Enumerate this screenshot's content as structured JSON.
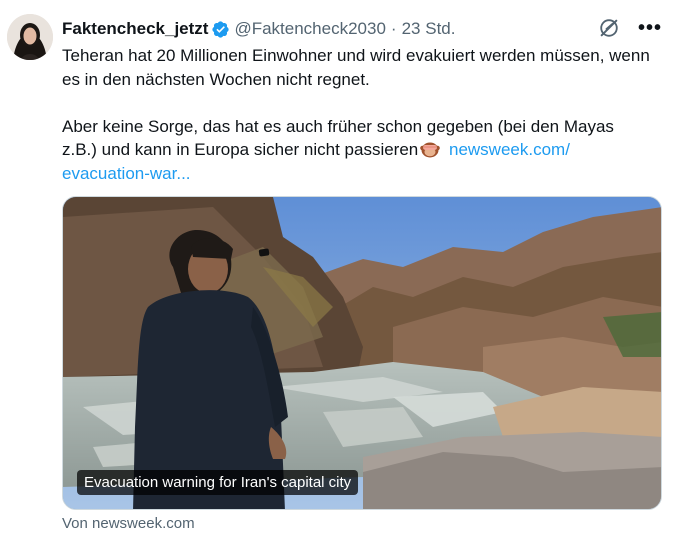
{
  "author": {
    "display_name": "Faktencheck_jetzt",
    "handle": "@Faktencheck2030",
    "time": "23 Std.",
    "separator": "·",
    "verified_icon": "verified-badge-icon"
  },
  "toolbar": {
    "grok_icon": "grok-icon",
    "more_icon": "more-icon"
  },
  "tweet": {
    "paragraph1": "Teheran hat 20 Millionen Einwohner und wird evakuiert werden müssen, wenn es in den nächsten Wochen nicht regnet.",
    "paragraph2": "Aber keine Sorge, das hat es auch früher schon gegeben (bei den Mayas z.B.) und kann in Europa sicher nicht passieren",
    "emoji": "see-no-evil-monkey-emoji",
    "link_line1": "newsweek.com/",
    "link_line2": "evacuation-war..."
  },
  "card": {
    "caption": "Evacuation warning for Iran's capital city",
    "source": "Von newsweek.com"
  },
  "colors": {
    "link": "#1d9bf0",
    "verified": "#1d9bf0",
    "muted": "#536471"
  }
}
